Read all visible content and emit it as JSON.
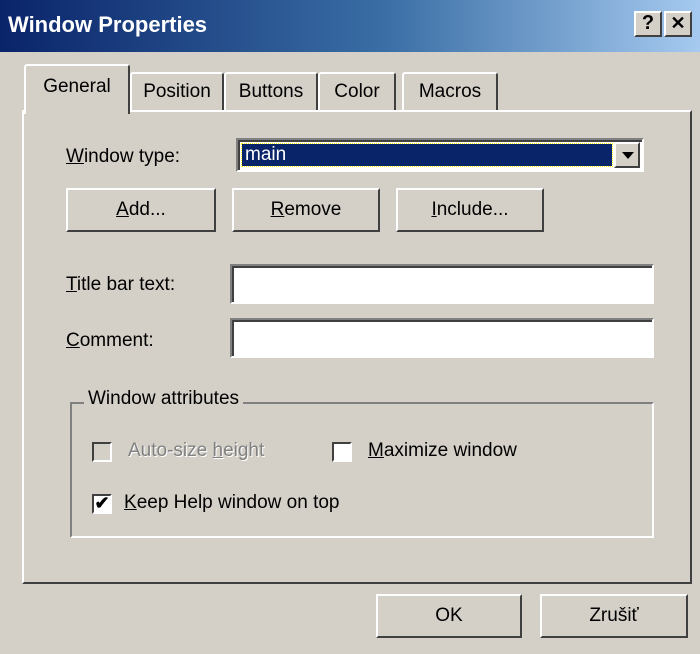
{
  "window": {
    "title": "Window Properties",
    "help_glyph": "?",
    "close_glyph": "✕"
  },
  "tabs": [
    {
      "label": "General",
      "active": true
    },
    {
      "label": "Position",
      "active": false
    },
    {
      "label": "Buttons",
      "active": false
    },
    {
      "label": "Color",
      "active": false
    },
    {
      "label": "Macros",
      "active": false
    }
  ],
  "general": {
    "window_type": {
      "label_first": "W",
      "label_rest": "indow type:",
      "selected": "main"
    },
    "buttons": {
      "add_first": "A",
      "add_rest": "dd...",
      "remove_first": "R",
      "remove_rest": "emove",
      "include_first": "I",
      "include_rest": "nclude..."
    },
    "title_bar": {
      "label_first": "T",
      "label_rest": "itle bar text:",
      "value": ""
    },
    "comment": {
      "label_first": "C",
      "label_rest": "omment:",
      "value": ""
    },
    "attributes": {
      "group_label": "Window attributes",
      "auto_size": {
        "pre": "Auto-size ",
        "acc": "h",
        "post": "eight",
        "checked": false,
        "enabled": false
      },
      "maximize": {
        "acc": "M",
        "post": "aximize window",
        "checked": false,
        "enabled": true
      },
      "keep_on_top": {
        "acc": "K",
        "post": "eep Help window on top",
        "checked": true,
        "enabled": true
      },
      "check_glyph": "✔"
    }
  },
  "footer": {
    "ok_label": "OK",
    "cancel_label": "Zrušiť"
  }
}
